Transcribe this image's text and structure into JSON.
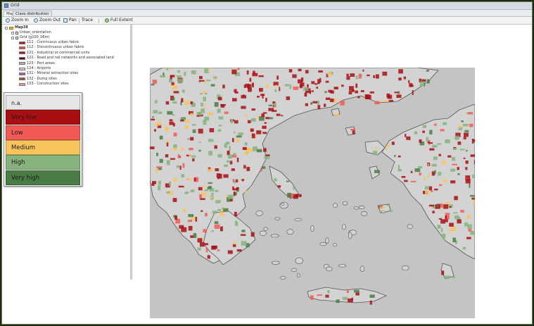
{
  "window": {
    "title": "Grid",
    "icon": "grid-app-icon"
  },
  "tabs": [
    {
      "label": "Map",
      "active": true
    },
    {
      "label": "Class distribution",
      "active": false
    }
  ],
  "toolbar": {
    "zoom_in": "Zoom In",
    "zoom_out": "Zoom Out",
    "pan": "Pan",
    "trace": "Trace",
    "full_extent": "Full Extent"
  },
  "tree": {
    "root": "Map38",
    "layers": [
      {
        "label": "Urban_orientation"
      },
      {
        "label": "Grid (g100_06m)"
      }
    ],
    "classes": [
      {
        "label": "111 - Continuous urban fabric",
        "color": "#b8171d"
      },
      {
        "label": "112 - Discontinuous urban fabric",
        "color": "#e8504a"
      },
      {
        "label": "121 - Industrial or commercial units",
        "color": "#a3211f"
      },
      {
        "label": "122 - Road and rail networks and associated land",
        "color": "#5c0f12"
      },
      {
        "label": "123 - Port areas",
        "color": "#c9a8a8"
      },
      {
        "label": "124 - Airports",
        "color": "#d5c5d9"
      },
      {
        "label": "131 - Mineral extraction sites",
        "color": "#a85bb2"
      },
      {
        "label": "132 - Dump sites",
        "color": "#8a5a2e"
      },
      {
        "label": "133 - Construction sites",
        "color": "#e89a9a"
      }
    ]
  },
  "legend": {
    "items": [
      {
        "label": "n.a.",
        "color": "#e6e6e6"
      },
      {
        "label": "Very low",
        "color": "#a90f12"
      },
      {
        "label": "Low",
        "color": "#f25a57"
      },
      {
        "label": "Medium",
        "color": "#f7c45e"
      },
      {
        "label": "High",
        "color": "#86b27c"
      },
      {
        "label": "Very high",
        "color": "#4a7d45"
      }
    ]
  },
  "map": {
    "sea_color": "#c4c4c4",
    "land_color": "#d3d3d3",
    "coast_color": "#555555"
  }
}
